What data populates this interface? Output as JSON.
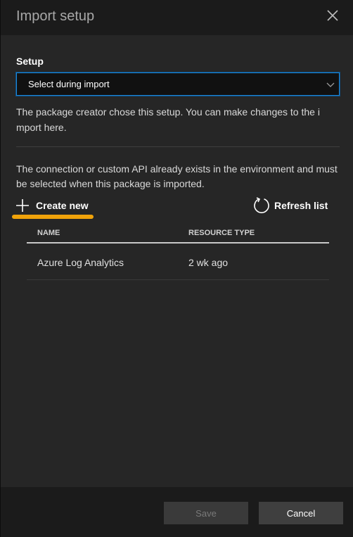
{
  "dialog": {
    "title": "Import setup",
    "close_icon": "close-icon"
  },
  "setup": {
    "label": "Setup",
    "selected": "Select during import",
    "description": "The package creator chose this setup. You can make changes to the i mport here."
  },
  "connection": {
    "description": "The connection or custom API already exists in the environment and must be selected when this package is imported.",
    "create_new_label": "Create new",
    "refresh_label": "Refresh list",
    "highlight_color": "#f0a30a"
  },
  "table": {
    "columns": [
      "NAME",
      "RESOURCE TYPE"
    ],
    "rows": [
      {
        "name": "Azure Log Analytics",
        "type": "2 wk ago"
      }
    ]
  },
  "footer": {
    "save_label": "Save",
    "cancel_label": "Cancel"
  },
  "colors": {
    "accent": "#1e88d8",
    "background": "#262626"
  }
}
